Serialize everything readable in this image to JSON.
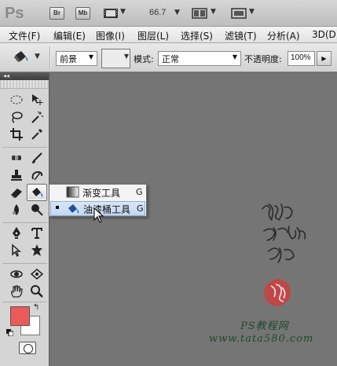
{
  "appbar": {
    "logo": "Ps",
    "bridge_button": "Br",
    "minibridge_button": "Mb",
    "zoom": "66.7",
    "dropdown_arrow": "▼"
  },
  "menu": {
    "items": [
      "文件(F)",
      "编辑(E)",
      "图像(I)",
      "图层(L)",
      "选择(S)",
      "滤镜(T)",
      "分析(A)",
      "3D(D)"
    ]
  },
  "options": {
    "fill_source": "前景",
    "mode_label": "模式:",
    "mode_value": "正常",
    "opacity_label": "不透明度:",
    "opacity_value": "100%"
  },
  "toolbox": {
    "collapse_label": "◂◂",
    "active_tool": "paint-bucket",
    "foreground_color": "#ea5a5a",
    "background_color": "#ffffff"
  },
  "flyout": {
    "items": [
      {
        "label": "渐变工具",
        "key": "G",
        "selected": false
      },
      {
        "label": "油漆桶工具",
        "key": "G",
        "selected": true
      }
    ]
  },
  "watermark": {
    "logo_text": "PS教程网",
    "url": "www.tata580.com"
  }
}
